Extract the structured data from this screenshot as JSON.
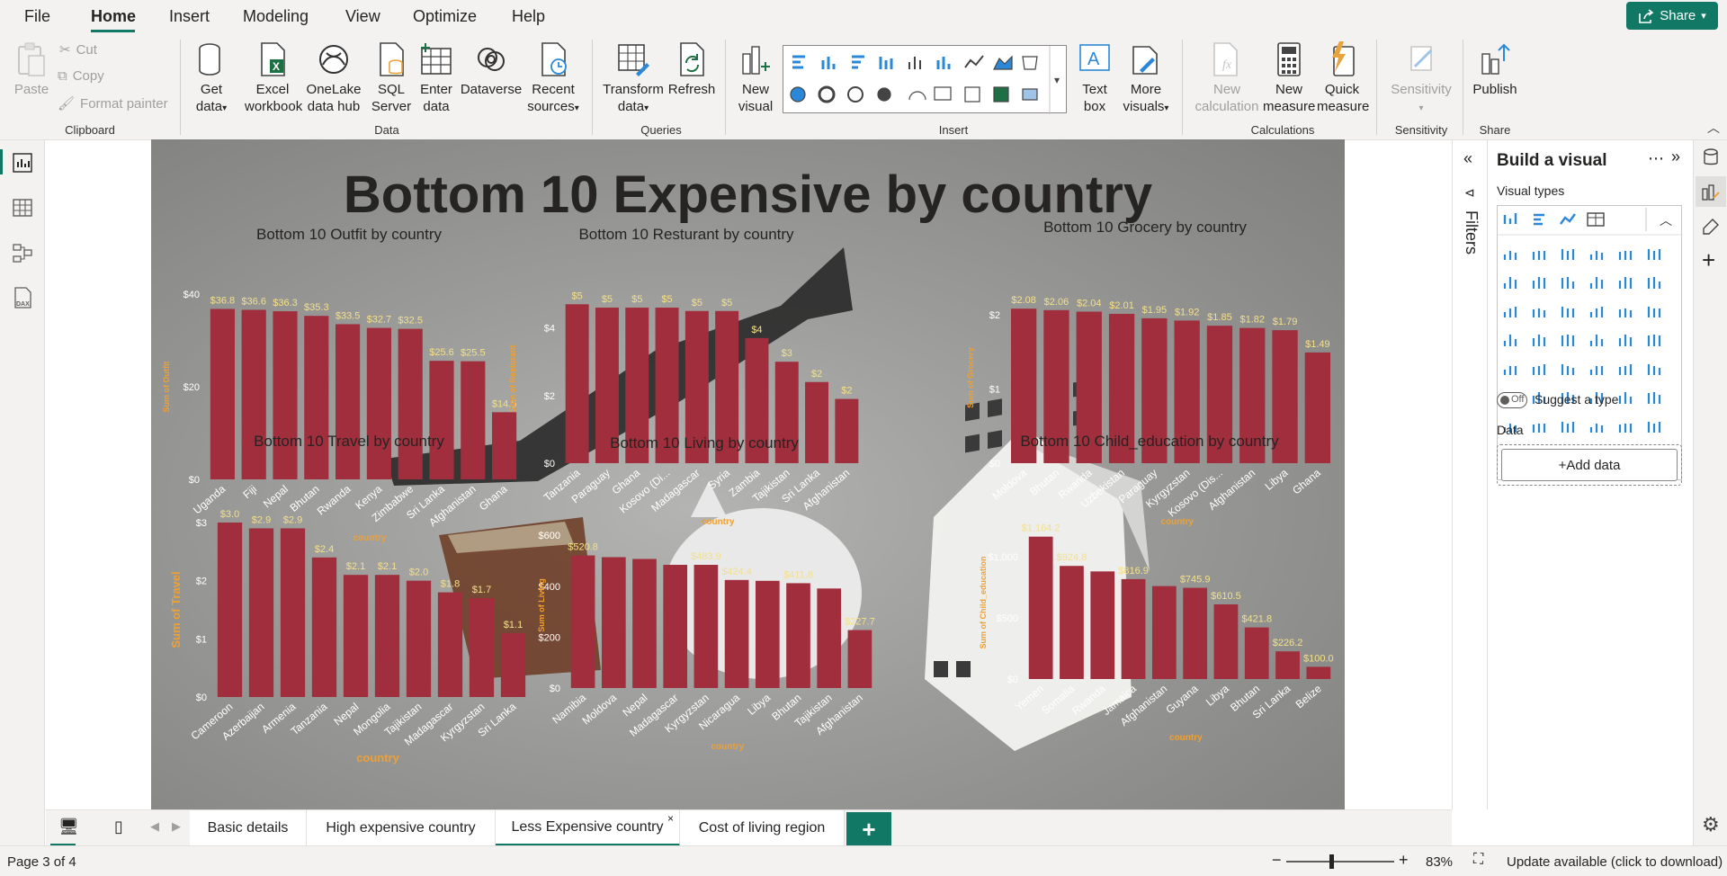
{
  "menu": {
    "items": [
      "File",
      "Home",
      "Insert",
      "Modeling",
      "View",
      "Optimize",
      "Help"
    ],
    "active": "Home",
    "share_label": "Share"
  },
  "ribbon": {
    "clipboard": {
      "paste": "Paste",
      "cut": "Cut",
      "copy": "Copy",
      "format_painter": "Format painter",
      "label": "Clipboard"
    },
    "data": {
      "get_data": [
        "Get",
        "data"
      ],
      "excel": [
        "Excel",
        "workbook"
      ],
      "onelake": [
        "OneLake",
        "data hub"
      ],
      "sql": [
        "SQL",
        "Server"
      ],
      "enter": [
        "Enter",
        "data"
      ],
      "dataverse": "Dataverse",
      "recent": [
        "Recent",
        "sources"
      ],
      "label": "Data"
    },
    "queries": {
      "transform": [
        "Transform",
        "data"
      ],
      "refresh": "Refresh",
      "label": "Queries"
    },
    "insert": {
      "new_visual": [
        "New",
        "visual"
      ],
      "text_box": [
        "Text",
        "box"
      ],
      "more_visuals": [
        "More",
        "visuals"
      ],
      "label": "Insert"
    },
    "calculations": {
      "new_calc": [
        "New",
        "calculation"
      ],
      "new_measure": [
        "New",
        "measure"
      ],
      "quick_measure": [
        "Quick",
        "measure"
      ],
      "label": "Calculations"
    },
    "sensitivity": {
      "btn": "Sensitivity",
      "label": "Sensitivity"
    },
    "share": {
      "publish": "Publish",
      "label": "Share"
    }
  },
  "report": {
    "title": "Bottom 10 Expensive by country",
    "background_accent": "#a12e3d"
  },
  "chart_data": [
    {
      "type": "bar",
      "title": "Bottom 10 Outfit by country",
      "xlabel": "country",
      "ylabel": "Sum of Outfit",
      "ylim": [
        0,
        40
      ],
      "yticks": [
        "$0",
        "$20",
        "$40"
      ],
      "categories": [
        "Uganda",
        "Fiji",
        "Nepal",
        "Bhutan",
        "Rwanda",
        "Kenya",
        "Zimbabwe",
        "Sri Lanka",
        "Afghanistan",
        "Ghana"
      ],
      "values": [
        36.8,
        36.6,
        36.3,
        35.3,
        33.5,
        32.7,
        32.5,
        25.6,
        25.5,
        14.5
      ],
      "labels": [
        "$36.8",
        "$36.6",
        "$36.3",
        "$35.3",
        "$33.5",
        "$32.7",
        "$32.5",
        "$25.6",
        "$25.5",
        "$14.5"
      ]
    },
    {
      "type": "bar",
      "title": "Bottom 10 Resturant by country",
      "xlabel": "country",
      "ylabel": "Sum of Resturant",
      "ylim": [
        0,
        5
      ],
      "yticks": [
        "$0",
        "$2",
        "$4"
      ],
      "categories": [
        "Tanzania",
        "Paraguay",
        "Ghana",
        "Kosovo (Di...",
        "Madagascar",
        "Syria",
        "Zambia",
        "Tajikistan",
        "Sri Lanka",
        "Afghanistan"
      ],
      "values": [
        4.7,
        4.6,
        4.6,
        4.6,
        4.5,
        4.5,
        3.7,
        3.0,
        2.4,
        1.9
      ],
      "labels": [
        "$5",
        "$5",
        "$5",
        "$5",
        "$5",
        "$5",
        "$4",
        "$3",
        "$2",
        "$2"
      ]
    },
    {
      "type": "bar",
      "title": "Bottom 10 Grocery by country",
      "xlabel": "country",
      "ylabel": "Sum of Grocery",
      "ylim": [
        0,
        2.3
      ],
      "yticks": [
        "$0",
        "$1",
        "$2"
      ],
      "categories": [
        "Moldova",
        "Bhutan",
        "Rwanda",
        "Uzbekistan",
        "Paraguay",
        "Kyrgyzstan",
        "Kosovo (Dis...",
        "Afghanistan",
        "Libya",
        "Ghana"
      ],
      "values": [
        2.08,
        2.06,
        2.04,
        2.01,
        1.95,
        1.92,
        1.85,
        1.82,
        1.79,
        1.49
      ],
      "labels": [
        "$2.08",
        "$2.06",
        "$2.04",
        "$2.01",
        "$1.95",
        "$1.92",
        "$1.85",
        "$1.82",
        "$1.79",
        "$1.49"
      ]
    },
    {
      "type": "bar",
      "title": "Bottom 10 Travel by country",
      "xlabel": "country",
      "ylabel": "Sum of Travel",
      "ylim": [
        0,
        3
      ],
      "yticks": [
        "$0",
        "$1",
        "$2",
        "$3"
      ],
      "categories": [
        "Cameroon",
        "Azerbaijan",
        "Armenia",
        "Tanzania",
        "Nepal",
        "Mongolia",
        "Tajikistan",
        "Madagascar",
        "Kyrgyzstan",
        "Sri Lanka"
      ],
      "values": [
        3.0,
        2.9,
        2.9,
        2.4,
        2.1,
        2.1,
        2.0,
        1.8,
        1.7,
        1.1
      ],
      "labels": [
        "$3.0",
        "$2.9",
        "$2.9",
        "$2.4",
        "$2.1",
        "$2.1",
        "$2.0",
        "$1.8",
        "$1.7",
        "$1.1"
      ]
    },
    {
      "type": "bar",
      "title": "Bottom 10 Living by country",
      "xlabel": "country",
      "ylabel": "Sum of Living",
      "ylim": [
        0,
        650
      ],
      "yticks": [
        "$0",
        "$200",
        "$400",
        "$600"
      ],
      "categories": [
        "Namibia",
        "Moldova",
        "Nepal",
        "Madagascar",
        "Kyrgyzstan",
        "Nicaragua",
        "Libya",
        "Bhutan",
        "Tajikistan",
        "Afghanistan"
      ],
      "values": [
        520.8,
        514.0,
        507.0,
        483.9,
        483.9,
        424.4,
        421.0,
        411.8,
        391.0,
        227.7
      ],
      "labels": [
        "$520.8",
        "",
        "",
        "",
        "$483.9",
        "$424.4",
        "",
        "$411.8",
        "",
        "$227.7"
      ]
    },
    {
      "type": "bar",
      "title": "Bottom 10 Child_education by country",
      "xlabel": "country",
      "ylabel": "Sum of Child_education",
      "ylim": [
        0,
        1250
      ],
      "yticks": [
        "$0",
        "$500",
        "$1,000"
      ],
      "categories": [
        "Yemen",
        "Somalia",
        "Rwanda",
        "Jamaica",
        "Afghanistan",
        "Guyana",
        "Libya",
        "Bhutan",
        "Sri Lanka",
        "Belize"
      ],
      "values": [
        1164.2,
        924.8,
        880.0,
        816.9,
        760.0,
        745.9,
        610.5,
        421.8,
        226.2,
        100.0
      ],
      "labels": [
        "$1,164.2",
        "$924.8",
        "",
        "$816.9",
        "",
        "$745.9",
        "$610.5",
        "$421.8",
        "$226.2",
        "$100.0"
      ]
    }
  ],
  "filters": {
    "label": "Filters"
  },
  "build": {
    "title": "Build a visual",
    "visual_types": "Visual types",
    "suggest": "Suggest a type",
    "toggle": "Off",
    "data_label": "Data",
    "add_data": "+Add data"
  },
  "tabs": [
    "Basic details",
    "High expensive country",
    "Less Expensive country",
    "Cost of living region"
  ],
  "active_tab": "Less Expensive country",
  "status": {
    "page": "Page 3 of 4",
    "zoom": "83%",
    "update": "Update available (click to download)"
  }
}
